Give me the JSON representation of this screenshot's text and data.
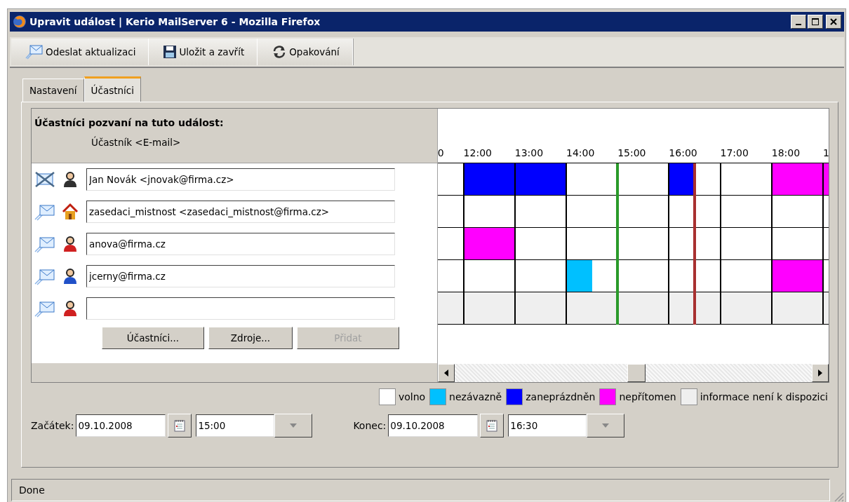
{
  "window": {
    "title": "Upravit událost | Kerio MailServer 6 - Mozilla Firefox"
  },
  "toolbar": [
    {
      "label": "Odeslat aktualizaci",
      "kind": "send"
    },
    {
      "label": "Uložit a zavřít",
      "kind": "save"
    },
    {
      "label": "Opakování",
      "kind": "repeat"
    }
  ],
  "tabs": [
    {
      "label": "Nastavení",
      "selected": false
    },
    {
      "label": "Účastníci",
      "selected": true
    }
  ],
  "attendees_title": "Účastníci pozvaní na tuto událost:",
  "attendee_column": "Účastník <E-mail>",
  "hours": [
    "0",
    "12:00",
    "13:00",
    "14:00",
    "15:00",
    "16:00",
    "17:00",
    "18:00",
    "1"
  ],
  "attendees": [
    {
      "value": "Jan Novák <jnovak@firma.cz>",
      "declined": true,
      "kind": "person",
      "color": "#303030",
      "slots": [
        {
          "kind": "free"
        },
        {
          "kind": "busy"
        },
        {
          "kind": "busy"
        },
        {
          "kind": "busy"
        },
        {
          "kind": "busy"
        },
        {
          "kind": "free"
        },
        {
          "kind": "free"
        },
        {
          "kind": "free"
        },
        {
          "kind": "free"
        },
        {
          "kind": "busy"
        },
        {
          "kind": "free"
        },
        {
          "kind": "free"
        },
        {
          "kind": "free"
        },
        {
          "kind": "away"
        },
        {
          "kind": "away"
        },
        {
          "kind": "away"
        }
      ]
    },
    {
      "value": "zasedaci_mistnost <zasedaci_mistnost@firma.cz>",
      "declined": false,
      "kind": "room",
      "color": "#e8a020",
      "slots": [
        {
          "kind": "free"
        },
        {
          "kind": "free"
        },
        {
          "kind": "free"
        },
        {
          "kind": "free"
        },
        {
          "kind": "free"
        },
        {
          "kind": "free"
        },
        {
          "kind": "free"
        },
        {
          "kind": "free"
        },
        {
          "kind": "free"
        },
        {
          "kind": "free"
        },
        {
          "kind": "free"
        },
        {
          "kind": "free"
        },
        {
          "kind": "free"
        },
        {
          "kind": "free"
        },
        {
          "kind": "free"
        },
        {
          "kind": "free"
        }
      ]
    },
    {
      "value": "anova@firma.cz",
      "declined": false,
      "kind": "person",
      "color": "#d02020",
      "slots": [
        {
          "kind": "free"
        },
        {
          "kind": "away"
        },
        {
          "kind": "away"
        },
        {
          "kind": "free"
        },
        {
          "kind": "free"
        },
        {
          "kind": "free"
        },
        {
          "kind": "free"
        },
        {
          "kind": "free"
        },
        {
          "kind": "free"
        },
        {
          "kind": "free"
        },
        {
          "kind": "free"
        },
        {
          "kind": "free"
        },
        {
          "kind": "free"
        },
        {
          "kind": "free"
        },
        {
          "kind": "free"
        },
        {
          "kind": "free"
        }
      ]
    },
    {
      "value": "jcerny@firma.cz",
      "declined": false,
      "kind": "person",
      "color": "#2050c8",
      "slots": [
        {
          "kind": "free"
        },
        {
          "kind": "free"
        },
        {
          "kind": "free"
        },
        {
          "kind": "free"
        },
        {
          "kind": "free"
        },
        {
          "kind": "tentative"
        },
        {
          "kind": "free"
        },
        {
          "kind": "free"
        },
        {
          "kind": "free"
        },
        {
          "kind": "free"
        },
        {
          "kind": "free"
        },
        {
          "kind": "free"
        },
        {
          "kind": "free"
        },
        {
          "kind": "away"
        },
        {
          "kind": "away"
        },
        {
          "kind": "free"
        }
      ]
    },
    {
      "declined": false,
      "kind": "person",
      "color": "#d02020",
      "slots": [
        {
          "kind": "unknown"
        },
        {
          "kind": "unknown"
        },
        {
          "kind": "unknown"
        },
        {
          "kind": "unknown"
        },
        {
          "kind": "unknown"
        },
        {
          "kind": "unknown"
        },
        {
          "kind": "unknown"
        },
        {
          "kind": "unknown"
        },
        {
          "kind": "unknown"
        },
        {
          "kind": "unknown"
        },
        {
          "kind": "unknown"
        },
        {
          "kind": "unknown"
        },
        {
          "kind": "unknown"
        },
        {
          "kind": "unknown"
        },
        {
          "kind": "unknown"
        },
        {
          "kind": "unknown"
        }
      ]
    }
  ],
  "buttons": [
    {
      "label": "Účastníci...",
      "disabled": false
    },
    {
      "label": "Zdroje...",
      "disabled": false
    },
    {
      "label": "Přidat",
      "disabled": true
    }
  ],
  "legend": [
    {
      "kind": "free",
      "label": "volno",
      "color": "#ffffff"
    },
    {
      "kind": "tentative",
      "label": "nezávazně",
      "color": "#00c0ff"
    },
    {
      "kind": "busy",
      "label": "zaneprázdněn",
      "color": "#0000ff"
    },
    {
      "kind": "away",
      "label": "nepřítomen",
      "color": "#ff00ff"
    },
    {
      "kind": "unknown",
      "label": "informace není k dispozici",
      "color": "#efefef"
    }
  ],
  "start": {
    "label": "Začátek:",
    "date": "09.10.2008",
    "time": "15:00"
  },
  "end": {
    "label": "Konec:",
    "date": "09.10.2008",
    "time": "16:30"
  },
  "status_bar": "Done"
}
